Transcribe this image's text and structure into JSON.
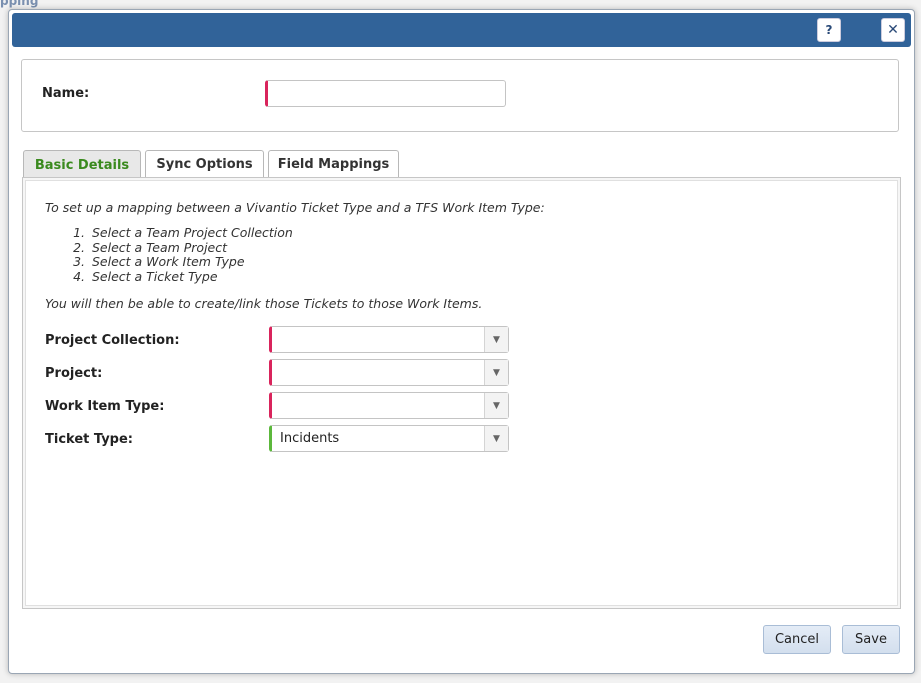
{
  "background": {
    "fragment_text": "pping"
  },
  "titlebar": {
    "help_label": "?",
    "close_label": "✕"
  },
  "name_field": {
    "label": "Name:",
    "value": "",
    "placeholder": ""
  },
  "tabs": [
    {
      "label": "Basic Details",
      "active": true
    },
    {
      "label": "Sync Options",
      "active": false
    },
    {
      "label": "Field Mappings",
      "active": false
    }
  ],
  "basic_details": {
    "intro": "To set up a mapping between a Vivantio Ticket Type and a TFS Work Item Type:",
    "steps": [
      {
        "num": "1.",
        "text": "Select a Team Project Collection"
      },
      {
        "num": "2.",
        "text": "Select a Team Project"
      },
      {
        "num": "3.",
        "text": "Select a Work Item Type"
      },
      {
        "num": "4.",
        "text": "Select a Ticket Type"
      }
    ],
    "outro": "You will then be able to create/link those Tickets to those Work Items.",
    "fields": [
      {
        "label": "Project Collection:",
        "value": ""
      },
      {
        "label": "Project:",
        "value": ""
      },
      {
        "label": "Work Item Type:",
        "value": ""
      },
      {
        "label": "Ticket Type:",
        "value": "Incidents"
      }
    ]
  },
  "footer": {
    "cancel_label": "Cancel",
    "save_label": "Save"
  },
  "colors": {
    "titlebar": "#316399",
    "required": "#d9245c",
    "valid": "#5cb83c",
    "active_tab_text": "#3a8a1e"
  },
  "icons": {
    "help": "question-icon",
    "close": "close-icon",
    "dropdown": "chevron-down-icon"
  }
}
